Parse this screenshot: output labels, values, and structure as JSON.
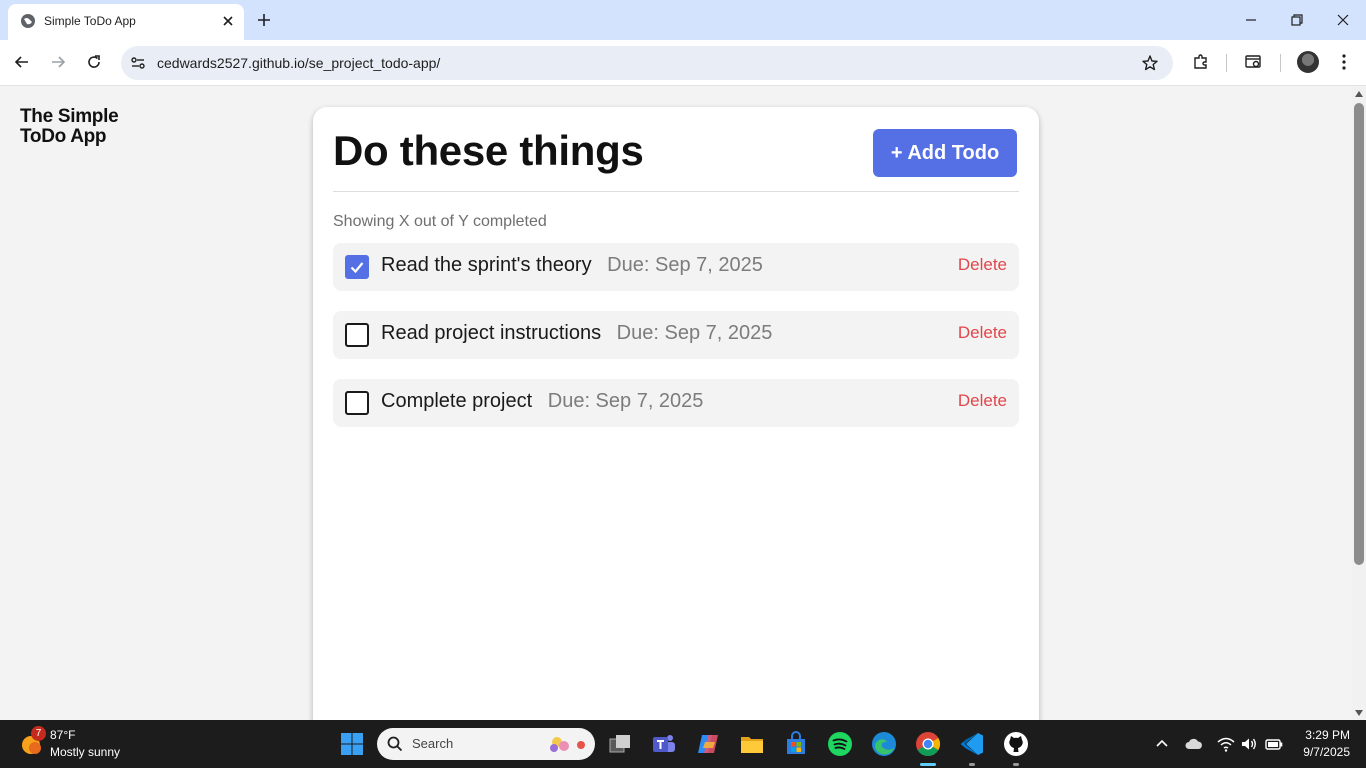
{
  "browser": {
    "tab_title": "Simple ToDo App",
    "url": "cedwards2527.github.io/se_project_todo-app/"
  },
  "page": {
    "logo_line1": "The Simple",
    "logo_line2": "ToDo App",
    "title": "Do these things",
    "add_button_label": "+ Add Todo",
    "counter_text": "Showing X out of Y completed",
    "todos": [
      {
        "name": "Read the sprint's theory",
        "due": "Due: Sep 7, 2025",
        "completed": true,
        "delete_label": "Delete"
      },
      {
        "name": "Read project instructions",
        "due": "Due: Sep 7, 2025",
        "completed": false,
        "delete_label": "Delete"
      },
      {
        "name": "Complete project",
        "due": "Due: Sep 7, 2025",
        "completed": false,
        "delete_label": "Delete"
      }
    ]
  },
  "taskbar": {
    "weather_badge": "7",
    "weather_temp": "87°F",
    "weather_desc": "Mostly sunny",
    "search_placeholder": "Search",
    "time": "3:29 PM",
    "date": "9/7/2025"
  },
  "colors": {
    "accent": "#5570e4",
    "delete": "#e0464a",
    "chrome_titlebar": "#d3e3fd"
  }
}
